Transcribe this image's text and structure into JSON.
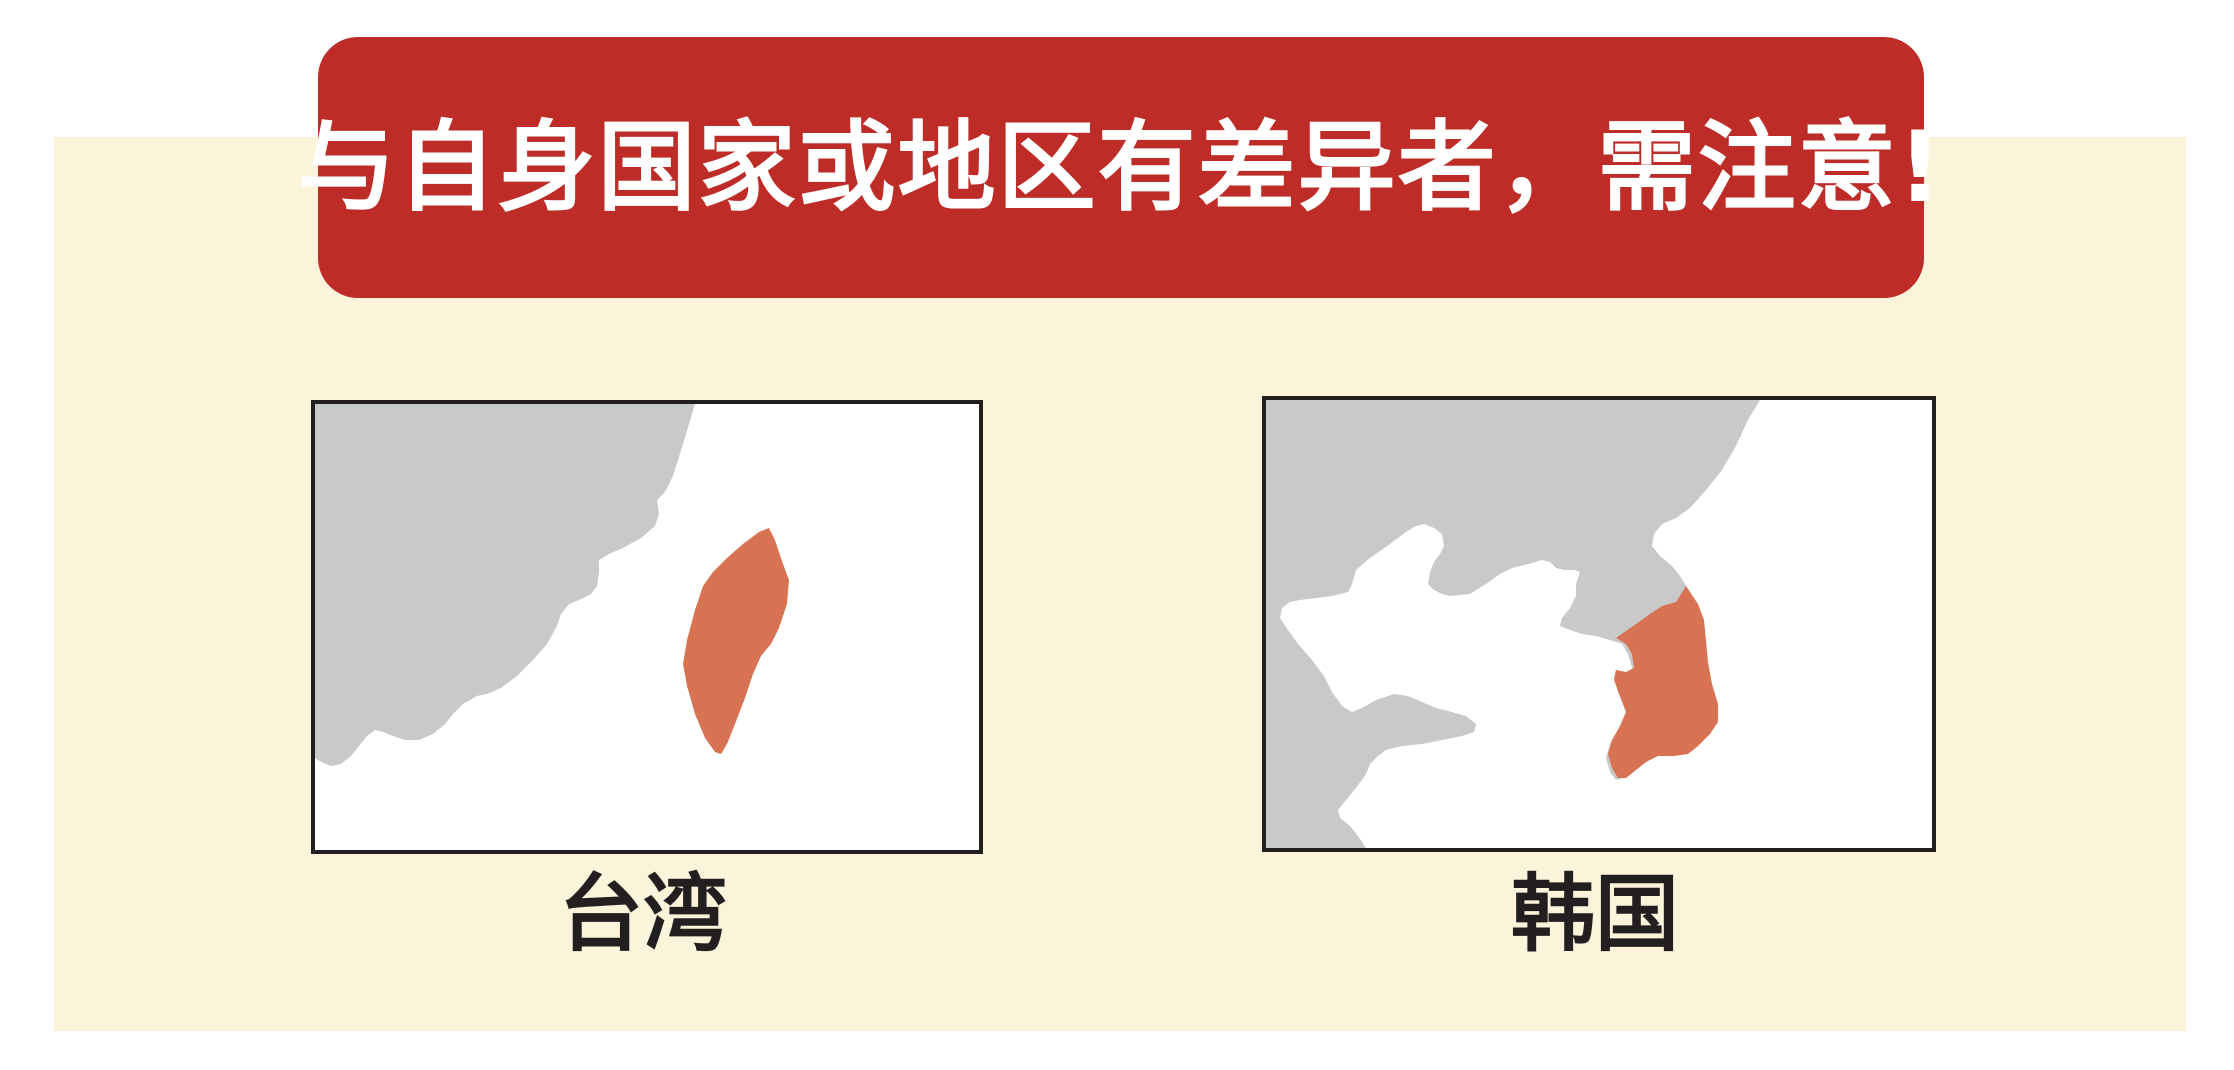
{
  "banner": {
    "text": "与自身国家或地区有差异者，需注意!"
  },
  "maps": [
    {
      "id": "taiwan",
      "label": "台湾"
    },
    {
      "id": "korea",
      "label": "韩国"
    }
  ],
  "colors": {
    "background": "#ffffff",
    "panel": "#fbf3da",
    "banner": "#be2c28",
    "banner_text": "#ffffff",
    "land_gray": "#c8c9c9",
    "highlight": "#d77352",
    "frame": "#231f20",
    "caption_text": "#231f20"
  }
}
